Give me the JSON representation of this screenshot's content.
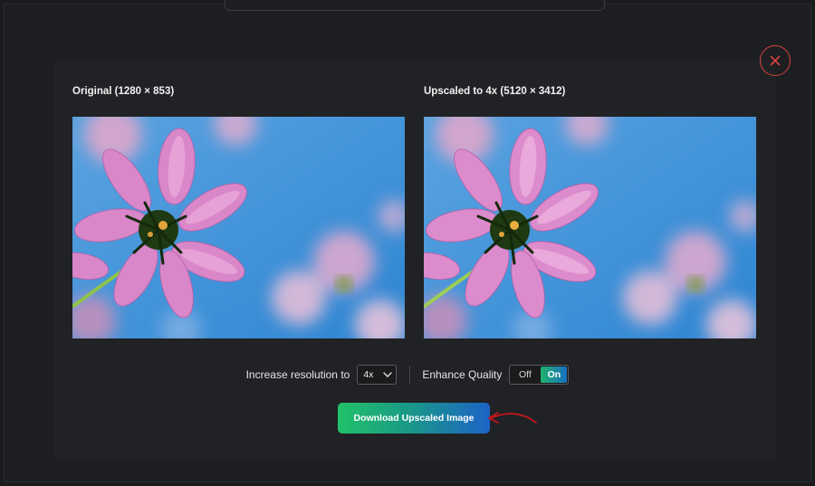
{
  "modal": {
    "original_title": "Original (1280 × 853)",
    "upscaled_title": "Upscaled to 4x (5120 × 3412)"
  },
  "controls": {
    "resolution_label": "Increase resolution to",
    "resolution_value": "4x",
    "enhance_label": "Enhance Quality",
    "enhance_off": "Off",
    "enhance_on": "On"
  },
  "actions": {
    "download_label": "Download Upscaled Image"
  },
  "colors": {
    "close_accent": "#d9453f",
    "gradient_start": "#22c26a",
    "gradient_end": "#1d63c7",
    "annotation_arrow": "#c4161c"
  },
  "icons": {
    "close": "close-icon",
    "dropdown": "chevron-down-icon",
    "annotation": "red-arrow-icon"
  }
}
